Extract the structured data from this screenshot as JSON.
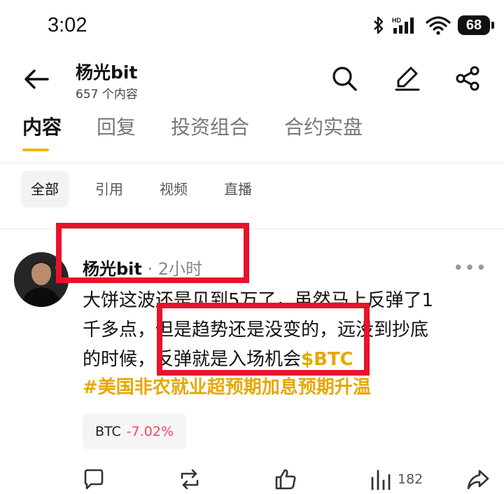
{
  "status_bar": {
    "time": "3:02",
    "battery": "68",
    "icons": [
      "bluetooth-icon",
      "hd-signal-icon",
      "wifi-icon",
      "battery-icon"
    ]
  },
  "header": {
    "title": "杨光bit",
    "subtitle": "657 个内容",
    "icons": [
      "back-arrow-icon",
      "search-icon",
      "edit-icon",
      "share-icon"
    ]
  },
  "main_tabs": [
    {
      "label": "内容",
      "active": true
    },
    {
      "label": "回复",
      "active": false
    },
    {
      "label": "投资组合",
      "active": false
    },
    {
      "label": "合约实盘",
      "active": false
    }
  ],
  "filter_chips": [
    {
      "label": "全部",
      "active": true
    },
    {
      "label": "引用",
      "active": false
    },
    {
      "label": "视频",
      "active": false
    },
    {
      "label": "直播",
      "active": false
    }
  ],
  "post": {
    "author": "杨光bit",
    "time": " · 2小时",
    "body_line1": "大饼这波还是见到5万了，虽然马上反弹了1",
    "body_line2": "千多点，但是趋势还是没变的，远没到抄底",
    "body_line3_text": "的时候，反弹就是入场机会",
    "body_line3_ticker": "$BTC",
    "hashtag": "#美国非农就业超预期加息预期升温",
    "ticker_chip": {
      "symbol": "BTC",
      "change": "-7.02%"
    },
    "actions": {
      "comment_icon": "comment-icon",
      "repost_icon": "repost-icon",
      "like_icon": "thumbs-up-icon",
      "views_icon": "views-icon",
      "views_count": "182",
      "share_icon": "share-arrow-icon"
    }
  },
  "colors": {
    "accent": "#f0b90b",
    "link": "#e6a800",
    "negative": "#f6465d",
    "highlight": "#e8122a"
  }
}
